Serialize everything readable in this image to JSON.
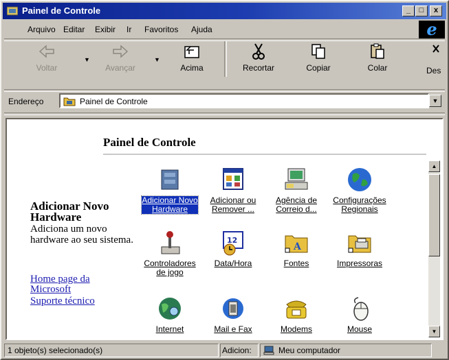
{
  "window": {
    "title": "Painel de Controle",
    "controls": {
      "minimize": "_",
      "maximize": "□",
      "close": "x"
    }
  },
  "menu": {
    "items": [
      "Arquivo",
      "Editar",
      "Exibir",
      "Ir",
      "Favoritos",
      "Ajuda"
    ]
  },
  "toolbar": {
    "back": "Voltar",
    "forward": "Avançar",
    "up": "Acima",
    "cut": "Recortar",
    "copy": "Copiar",
    "paste": "Colar",
    "delete": "Des"
  },
  "address": {
    "label": "Endereço",
    "value": "Painel de Controle"
  },
  "content": {
    "title": "Painel de Controle",
    "info_title": "Adicionar Novo Hardware",
    "info_desc": "Adiciona um novo hardware ao seu sistema.",
    "links": [
      "Home page da Microsoft",
      "Suporte técnico"
    ],
    "items": [
      {
        "label": "Adicionar Novo Hardware",
        "icon": "add-hardware-icon",
        "selected": true
      },
      {
        "label": "Adicionar ou Remover ...",
        "icon": "add-remove-programs-icon"
      },
      {
        "label": "Agência de Correio d...",
        "icon": "mail-postoffice-icon"
      },
      {
        "label": "Configurações Regionais",
        "icon": "globe-icon"
      },
      {
        "label": "Controladores de jogo",
        "icon": "joystick-icon"
      },
      {
        "label": "Data/Hora",
        "icon": "calendar-clock-icon"
      },
      {
        "label": "Fontes",
        "icon": "fonts-folder-icon"
      },
      {
        "label": "Impressoras",
        "icon": "printers-folder-icon"
      },
      {
        "label": "Internet",
        "icon": "internet-globe-icon"
      },
      {
        "label": "Mail e Fax",
        "icon": "mail-fax-icon"
      },
      {
        "label": "Modems",
        "icon": "telephone-icon"
      },
      {
        "label": "Mouse",
        "icon": "mouse-icon"
      }
    ]
  },
  "status": {
    "selection": "1 objeto(s) selecionado(s)",
    "action": "Adicion:",
    "location": "Meu computador"
  }
}
